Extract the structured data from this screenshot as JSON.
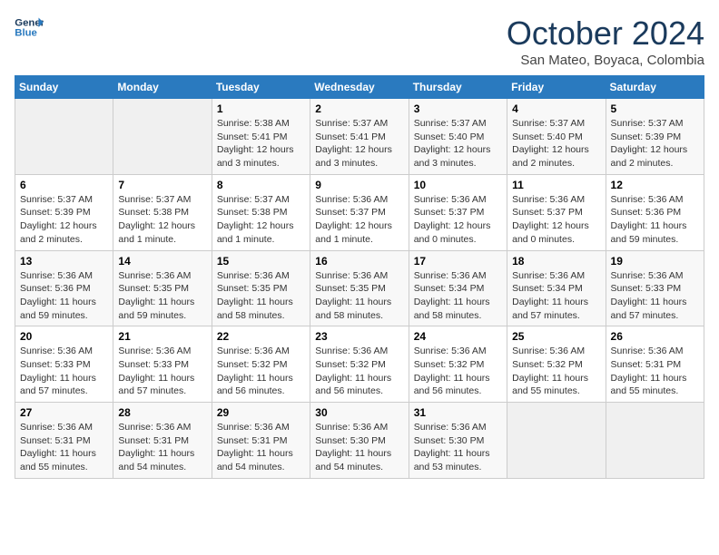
{
  "header": {
    "logo_line1": "General",
    "logo_line2": "Blue",
    "month": "October 2024",
    "location": "San Mateo, Boyaca, Colombia"
  },
  "weekdays": [
    "Sunday",
    "Monday",
    "Tuesday",
    "Wednesday",
    "Thursday",
    "Friday",
    "Saturday"
  ],
  "weeks": [
    [
      {
        "day": "",
        "detail": ""
      },
      {
        "day": "",
        "detail": ""
      },
      {
        "day": "1",
        "detail": "Sunrise: 5:38 AM\nSunset: 5:41 PM\nDaylight: 12 hours and 3 minutes."
      },
      {
        "day": "2",
        "detail": "Sunrise: 5:37 AM\nSunset: 5:41 PM\nDaylight: 12 hours and 3 minutes."
      },
      {
        "day": "3",
        "detail": "Sunrise: 5:37 AM\nSunset: 5:40 PM\nDaylight: 12 hours and 3 minutes."
      },
      {
        "day": "4",
        "detail": "Sunrise: 5:37 AM\nSunset: 5:40 PM\nDaylight: 12 hours and 2 minutes."
      },
      {
        "day": "5",
        "detail": "Sunrise: 5:37 AM\nSunset: 5:39 PM\nDaylight: 12 hours and 2 minutes."
      }
    ],
    [
      {
        "day": "6",
        "detail": "Sunrise: 5:37 AM\nSunset: 5:39 PM\nDaylight: 12 hours and 2 minutes."
      },
      {
        "day": "7",
        "detail": "Sunrise: 5:37 AM\nSunset: 5:38 PM\nDaylight: 12 hours and 1 minute."
      },
      {
        "day": "8",
        "detail": "Sunrise: 5:37 AM\nSunset: 5:38 PM\nDaylight: 12 hours and 1 minute."
      },
      {
        "day": "9",
        "detail": "Sunrise: 5:36 AM\nSunset: 5:37 PM\nDaylight: 12 hours and 1 minute."
      },
      {
        "day": "10",
        "detail": "Sunrise: 5:36 AM\nSunset: 5:37 PM\nDaylight: 12 hours and 0 minutes."
      },
      {
        "day": "11",
        "detail": "Sunrise: 5:36 AM\nSunset: 5:37 PM\nDaylight: 12 hours and 0 minutes."
      },
      {
        "day": "12",
        "detail": "Sunrise: 5:36 AM\nSunset: 5:36 PM\nDaylight: 11 hours and 59 minutes."
      }
    ],
    [
      {
        "day": "13",
        "detail": "Sunrise: 5:36 AM\nSunset: 5:36 PM\nDaylight: 11 hours and 59 minutes."
      },
      {
        "day": "14",
        "detail": "Sunrise: 5:36 AM\nSunset: 5:35 PM\nDaylight: 11 hours and 59 minutes."
      },
      {
        "day": "15",
        "detail": "Sunrise: 5:36 AM\nSunset: 5:35 PM\nDaylight: 11 hours and 58 minutes."
      },
      {
        "day": "16",
        "detail": "Sunrise: 5:36 AM\nSunset: 5:35 PM\nDaylight: 11 hours and 58 minutes."
      },
      {
        "day": "17",
        "detail": "Sunrise: 5:36 AM\nSunset: 5:34 PM\nDaylight: 11 hours and 58 minutes."
      },
      {
        "day": "18",
        "detail": "Sunrise: 5:36 AM\nSunset: 5:34 PM\nDaylight: 11 hours and 57 minutes."
      },
      {
        "day": "19",
        "detail": "Sunrise: 5:36 AM\nSunset: 5:33 PM\nDaylight: 11 hours and 57 minutes."
      }
    ],
    [
      {
        "day": "20",
        "detail": "Sunrise: 5:36 AM\nSunset: 5:33 PM\nDaylight: 11 hours and 57 minutes."
      },
      {
        "day": "21",
        "detail": "Sunrise: 5:36 AM\nSunset: 5:33 PM\nDaylight: 11 hours and 57 minutes."
      },
      {
        "day": "22",
        "detail": "Sunrise: 5:36 AM\nSunset: 5:32 PM\nDaylight: 11 hours and 56 minutes."
      },
      {
        "day": "23",
        "detail": "Sunrise: 5:36 AM\nSunset: 5:32 PM\nDaylight: 11 hours and 56 minutes."
      },
      {
        "day": "24",
        "detail": "Sunrise: 5:36 AM\nSunset: 5:32 PM\nDaylight: 11 hours and 56 minutes."
      },
      {
        "day": "25",
        "detail": "Sunrise: 5:36 AM\nSunset: 5:32 PM\nDaylight: 11 hours and 55 minutes."
      },
      {
        "day": "26",
        "detail": "Sunrise: 5:36 AM\nSunset: 5:31 PM\nDaylight: 11 hours and 55 minutes."
      }
    ],
    [
      {
        "day": "27",
        "detail": "Sunrise: 5:36 AM\nSunset: 5:31 PM\nDaylight: 11 hours and 55 minutes."
      },
      {
        "day": "28",
        "detail": "Sunrise: 5:36 AM\nSunset: 5:31 PM\nDaylight: 11 hours and 54 minutes."
      },
      {
        "day": "29",
        "detail": "Sunrise: 5:36 AM\nSunset: 5:31 PM\nDaylight: 11 hours and 54 minutes."
      },
      {
        "day": "30",
        "detail": "Sunrise: 5:36 AM\nSunset: 5:30 PM\nDaylight: 11 hours and 54 minutes."
      },
      {
        "day": "31",
        "detail": "Sunrise: 5:36 AM\nSunset: 5:30 PM\nDaylight: 11 hours and 53 minutes."
      },
      {
        "day": "",
        "detail": ""
      },
      {
        "day": "",
        "detail": ""
      }
    ]
  ]
}
